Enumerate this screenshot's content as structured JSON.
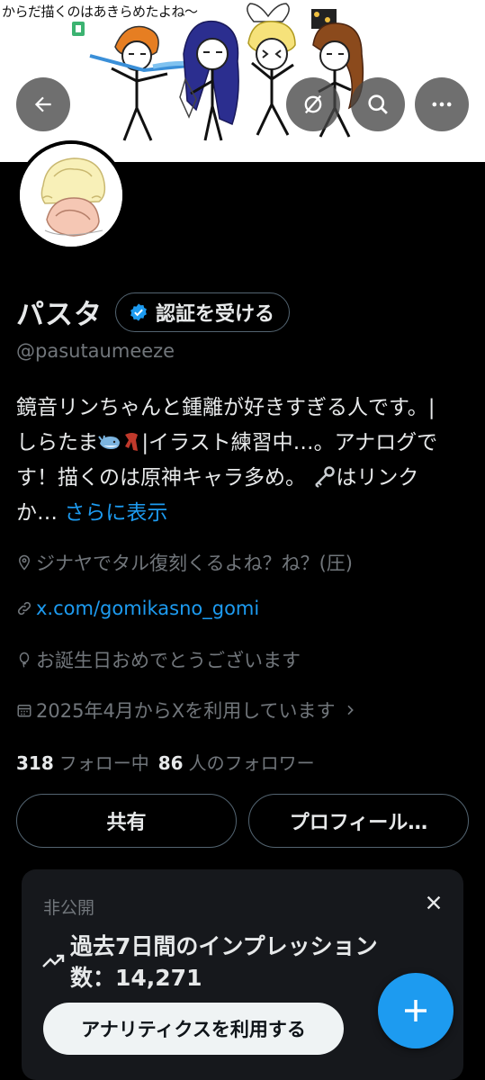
{
  "banner": {
    "caption": "からだ描くのはあきらめたよね〜"
  },
  "topbar": {
    "back_icon": "arrow-left-icon",
    "hidden_icon": "eye-slash-icon",
    "search_icon": "search-icon",
    "more_icon": "more-horizontal-icon"
  },
  "profile": {
    "display_name": "パスタ",
    "verify_label": "認証を受ける",
    "handle": "@pasutaumeeze",
    "bio_line1": "鏡音リンちゃんと鍾離が好きすぎる人です。|",
    "bio_line2_a": "しらたま",
    "bio_line2_b": "|イラスト練習中…。アナログで",
    "bio_line3": "す！描くのは原神キャラ多め。",
    "bio_line3_b": "はリンク",
    "bio_line4": "か…",
    "bio_more": "さらに表示",
    "location": "ジナヤでタル復刻くるよね？ね？(圧)",
    "website": "x.com/gomikasno_gomi",
    "birthday": "お誕生日おめでとうございます",
    "joined": "2025年4月からXを利用しています"
  },
  "stats": {
    "following_count": "318",
    "following_label": "フォロー中",
    "followers_count": "86",
    "followers_label": "人のフォロワー"
  },
  "actions": {
    "share_label": "共有",
    "edit_label": "プロフィール…"
  },
  "impressions_card": {
    "private_label": "非公開",
    "stat_text": "過去7日間のインプレッション数：14,271",
    "analytics_button": "アナリティクスを利用する"
  },
  "colors": {
    "accent": "#1d9bf0",
    "background": "#000000",
    "muted_text": "#71767b",
    "card_bg": "#16181c"
  }
}
